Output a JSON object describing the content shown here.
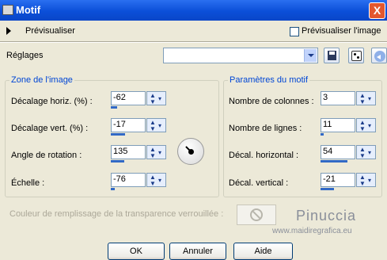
{
  "window": {
    "title": "Motif",
    "close_glyph": "X"
  },
  "preview": {
    "label": "Prévisualiser",
    "checkbox_label": "Prévisualiser l'image",
    "checked": false
  },
  "settings": {
    "label": "Réglages",
    "value": ""
  },
  "image_zone": {
    "title": "Zone de l'image",
    "fields": [
      {
        "label": "Décalage horiz. (%) :",
        "value": "-62",
        "fill": 0.19
      },
      {
        "label": "Décalage vert. (%) :",
        "value": "-17",
        "fill": 0.415
      },
      {
        "label": "Angle de rotation :",
        "value": "135",
        "fill": 0.375
      },
      {
        "label": "Échelle :",
        "value": "-76",
        "fill": 0.12
      }
    ],
    "angle_dial_deg": 135
  },
  "motif_params": {
    "title": "Paramètres du motif",
    "fields": [
      {
        "label": "Nombre de colonnes :",
        "value": "3",
        "fill": 0.0
      },
      {
        "label": "Nombre de lignes :",
        "value": "11",
        "fill": 0.1
      },
      {
        "label": "Décal. horizontal :",
        "value": "54",
        "fill": 0.77
      },
      {
        "label": "Décal. vertical :",
        "value": "-21",
        "fill": 0.395
      }
    ]
  },
  "fill_color": {
    "label": "Couleur de remplissage de la transparence verrouillée :",
    "disabled": true
  },
  "watermark": {
    "name": "Pinuccia",
    "url": "www.maidiregrafica.eu"
  },
  "buttons": {
    "ok": "OK",
    "cancel": "Annuler",
    "help": "Aide"
  },
  "icons": {
    "save": "save-icon",
    "dice": "dice-icon",
    "reset": "reset-icon"
  },
  "colors": {
    "title_bar": "#0b4fd8",
    "group_title": "#0046d5",
    "face": "#ece9d8",
    "spin_bar": "#3169c6"
  }
}
